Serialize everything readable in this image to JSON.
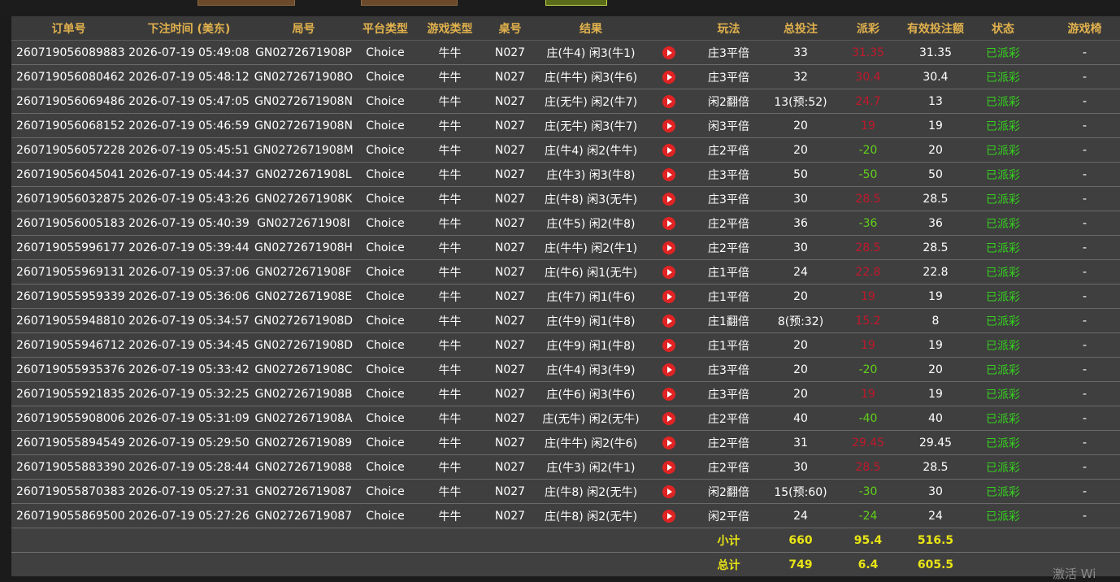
{
  "columns": [
    "订单号",
    "下注时间 (美东)",
    "局号",
    "平台类型",
    "游戏类型",
    "桌号",
    "结果",
    "",
    "玩法",
    "总投注",
    "派彩",
    "有效投注额",
    "状态",
    "游戏椅"
  ],
  "rows": [
    {
      "order": "260719056089883",
      "time": "2026-07-19 05:49:08",
      "round": "GN0272671908P",
      "platform": "Choice",
      "game": "牛牛",
      "table": "N027",
      "result": "庄(牛4) 闲3(牛1)",
      "play": "庄3平倍",
      "bet": "33",
      "payout": "31.35",
      "payout_color": "red",
      "valid": "31.35",
      "status": "已派彩",
      "extra": "-"
    },
    {
      "order": "260719056080462",
      "time": "2026-07-19 05:48:12",
      "round": "GN0272671908O",
      "platform": "Choice",
      "game": "牛牛",
      "table": "N027",
      "result": "庄(牛牛) 闲3(牛6)",
      "play": "庄3平倍",
      "bet": "32",
      "payout": "30.4",
      "payout_color": "red",
      "valid": "30.4",
      "status": "已派彩",
      "extra": "-"
    },
    {
      "order": "260719056069486",
      "time": "2026-07-19 05:47:05",
      "round": "GN0272671908N",
      "platform": "Choice",
      "game": "牛牛",
      "table": "N027",
      "result": "庄(无牛) 闲2(牛7)",
      "play": "闲2翻倍",
      "bet": "13(预:52)",
      "payout": "24.7",
      "payout_color": "red",
      "valid": "13",
      "status": "已派彩",
      "extra": "-"
    },
    {
      "order": "260719056068152",
      "time": "2026-07-19 05:46:59",
      "round": "GN0272671908N",
      "platform": "Choice",
      "game": "牛牛",
      "table": "N027",
      "result": "庄(无牛) 闲3(牛7)",
      "play": "闲3平倍",
      "bet": "20",
      "payout": "19",
      "payout_color": "red",
      "valid": "19",
      "status": "已派彩",
      "extra": "-"
    },
    {
      "order": "260719056057228",
      "time": "2026-07-19 05:45:51",
      "round": "GN0272671908M",
      "platform": "Choice",
      "game": "牛牛",
      "table": "N027",
      "result": "庄(牛4) 闲2(牛牛)",
      "play": "庄2平倍",
      "bet": "20",
      "payout": "-20",
      "payout_color": "green",
      "valid": "20",
      "status": "已派彩",
      "extra": "-"
    },
    {
      "order": "260719056045041",
      "time": "2026-07-19 05:44:37",
      "round": "GN0272671908L",
      "platform": "Choice",
      "game": "牛牛",
      "table": "N027",
      "result": "庄(牛3) 闲3(牛8)",
      "play": "庄3平倍",
      "bet": "50",
      "payout": "-50",
      "payout_color": "green",
      "valid": "50",
      "status": "已派彩",
      "extra": "-"
    },
    {
      "order": "260719056032875",
      "time": "2026-07-19 05:43:26",
      "round": "GN0272671908K",
      "platform": "Choice",
      "game": "牛牛",
      "table": "N027",
      "result": "庄(牛8) 闲3(无牛)",
      "play": "庄3平倍",
      "bet": "30",
      "payout": "28.5",
      "payout_color": "red",
      "valid": "28.5",
      "status": "已派彩",
      "extra": "-"
    },
    {
      "order": "260719056005183",
      "time": "2026-07-19 05:40:39",
      "round": "GN0272671908I",
      "platform": "Choice",
      "game": "牛牛",
      "table": "N027",
      "result": "庄(牛5) 闲2(牛8)",
      "play": "庄2平倍",
      "bet": "36",
      "payout": "-36",
      "payout_color": "green",
      "valid": "36",
      "status": "已派彩",
      "extra": "-"
    },
    {
      "order": "260719055996177",
      "time": "2026-07-19 05:39:44",
      "round": "GN0272671908H",
      "platform": "Choice",
      "game": "牛牛",
      "table": "N027",
      "result": "庄(牛牛) 闲2(牛1)",
      "play": "庄2平倍",
      "bet": "30",
      "payout": "28.5",
      "payout_color": "red",
      "valid": "28.5",
      "status": "已派彩",
      "extra": "-"
    },
    {
      "order": "260719055969131",
      "time": "2026-07-19 05:37:06",
      "round": "GN0272671908F",
      "platform": "Choice",
      "game": "牛牛",
      "table": "N027",
      "result": "庄(牛6) 闲1(无牛)",
      "play": "庄1平倍",
      "bet": "24",
      "payout": "22.8",
      "payout_color": "red",
      "valid": "22.8",
      "status": "已派彩",
      "extra": "-"
    },
    {
      "order": "260719055959339",
      "time": "2026-07-19 05:36:06",
      "round": "GN0272671908E",
      "platform": "Choice",
      "game": "牛牛",
      "table": "N027",
      "result": "庄(牛7) 闲1(牛6)",
      "play": "庄1平倍",
      "bet": "20",
      "payout": "19",
      "payout_color": "red",
      "valid": "19",
      "status": "已派彩",
      "extra": "-"
    },
    {
      "order": "260719055948810",
      "time": "2026-07-19 05:34:57",
      "round": "GN0272671908D",
      "platform": "Choice",
      "game": "牛牛",
      "table": "N027",
      "result": "庄(牛9) 闲1(牛8)",
      "play": "庄1翻倍",
      "bet": "8(预:32)",
      "payout": "15.2",
      "payout_color": "red",
      "valid": "8",
      "status": "已派彩",
      "extra": "-"
    },
    {
      "order": "260719055946712",
      "time": "2026-07-19 05:34:45",
      "round": "GN0272671908D",
      "platform": "Choice",
      "game": "牛牛",
      "table": "N027",
      "result": "庄(牛9) 闲1(牛8)",
      "play": "庄1平倍",
      "bet": "20",
      "payout": "19",
      "payout_color": "red",
      "valid": "19",
      "status": "已派彩",
      "extra": "-"
    },
    {
      "order": "260719055935376",
      "time": "2026-07-19 05:33:42",
      "round": "GN0272671908C",
      "platform": "Choice",
      "game": "牛牛",
      "table": "N027",
      "result": "庄(牛4) 闲3(牛9)",
      "play": "庄3平倍",
      "bet": "20",
      "payout": "-20",
      "payout_color": "green",
      "valid": "20",
      "status": "已派彩",
      "extra": "-"
    },
    {
      "order": "260719055921835",
      "time": "2026-07-19 05:32:25",
      "round": "GN0272671908B",
      "platform": "Choice",
      "game": "牛牛",
      "table": "N027",
      "result": "庄(牛6) 闲3(牛6)",
      "play": "庄3平倍",
      "bet": "20",
      "payout": "19",
      "payout_color": "red",
      "valid": "19",
      "status": "已派彩",
      "extra": "-"
    },
    {
      "order": "260719055908006",
      "time": "2026-07-19 05:31:09",
      "round": "GN0272671908A",
      "platform": "Choice",
      "game": "牛牛",
      "table": "N027",
      "result": "庄(无牛) 闲2(无牛)",
      "play": "庄2平倍",
      "bet": "40",
      "payout": "-40",
      "payout_color": "green",
      "valid": "40",
      "status": "已派彩",
      "extra": "-"
    },
    {
      "order": "260719055894549",
      "time": "2026-07-19 05:29:50",
      "round": "GN02726719089",
      "platform": "Choice",
      "game": "牛牛",
      "table": "N027",
      "result": "庄(牛牛) 闲2(牛6)",
      "play": "庄2平倍",
      "bet": "31",
      "payout": "29.45",
      "payout_color": "red",
      "valid": "29.45",
      "status": "已派彩",
      "extra": "-"
    },
    {
      "order": "260719055883390",
      "time": "2026-07-19 05:28:44",
      "round": "GN02726719088",
      "platform": "Choice",
      "game": "牛牛",
      "table": "N027",
      "result": "庄(牛3) 闲2(牛1)",
      "play": "庄2平倍",
      "bet": "30",
      "payout": "28.5",
      "payout_color": "red",
      "valid": "28.5",
      "status": "已派彩",
      "extra": "-"
    },
    {
      "order": "260719055870383",
      "time": "2026-07-19 05:27:31",
      "round": "GN02726719087",
      "platform": "Choice",
      "game": "牛牛",
      "table": "N027",
      "result": "庄(牛8) 闲2(无牛)",
      "play": "闲2翻倍",
      "bet": "15(预:60)",
      "payout": "-30",
      "payout_color": "green",
      "valid": "30",
      "status": "已派彩",
      "extra": "-"
    },
    {
      "order": "260719055869500",
      "time": "2026-07-19 05:27:26",
      "round": "GN02726719087",
      "platform": "Choice",
      "game": "牛牛",
      "table": "N027",
      "result": "庄(牛8) 闲2(无牛)",
      "play": "闲2平倍",
      "bet": "24",
      "payout": "-24",
      "payout_color": "green",
      "valid": "24",
      "status": "已派彩",
      "extra": "-"
    }
  ],
  "subtotal": {
    "label": "小计",
    "bet": "660",
    "payout": "95.4",
    "valid": "516.5"
  },
  "total": {
    "label": "总计",
    "bet": "749",
    "payout": "6.4",
    "valid": "605.5"
  },
  "colors": {
    "payout_red": "#c2182b",
    "payout_green": "#61d11a",
    "status_green": "#35d21e",
    "header_gold": "#e2b24d",
    "summary_yellow": "#e9e515"
  },
  "watermark": "激活 Wi",
  "icons": {
    "result_video": "play-icon"
  }
}
